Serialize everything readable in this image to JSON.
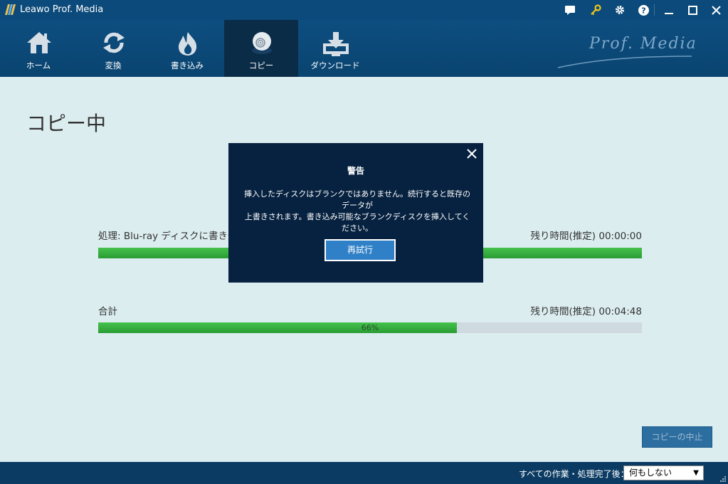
{
  "app": {
    "title": "Leawo Prof. Media"
  },
  "titlebar": {
    "icons": [
      "chat-icon",
      "key-icon",
      "gear-icon",
      "help-icon",
      "minimize-icon",
      "maximize-icon",
      "close-icon"
    ],
    "key_color": "#f5c518"
  },
  "nav": {
    "tabs": [
      {
        "label": "ホーム",
        "icon": "home-icon",
        "active": false
      },
      {
        "label": "変換",
        "icon": "convert-icon",
        "active": false
      },
      {
        "label": "書き込み",
        "icon": "burn-icon",
        "active": false
      },
      {
        "label": "コピー",
        "icon": "disc-icon",
        "active": true
      },
      {
        "label": "ダウンロード",
        "icon": "download-icon",
        "active": false
      }
    ],
    "brand": "Prof. Media"
  },
  "main": {
    "title": "コピー中",
    "process": {
      "label": "処理: Blu-ray ディスクに書き込",
      "remaining": "残り時間(推定) 00:00:00",
      "progress": 1.0
    },
    "total": {
      "label": "合計",
      "remaining": "残り時間(推定) 00:04:48",
      "progress": 0.66,
      "percent_text": "66%"
    },
    "stop_button": "コピーの中止"
  },
  "modal": {
    "title": "警告",
    "message_line1": "挿入したディスクはブランクではありません。続行すると既存のデータが",
    "message_line2": "上書きされます。書き込み可能なブランクディスクを挿入してください。",
    "retry_button": "再試行"
  },
  "bottombar": {
    "after_label": "すべての作業・処理完了後：",
    "after_value": "何もしない"
  },
  "colors": {
    "titlebar": "#0b4a7a",
    "active_tab": "#0a2c47",
    "progress": "#2a9c34",
    "modal_bg": "#072240",
    "modal_button": "#2f80c7"
  }
}
